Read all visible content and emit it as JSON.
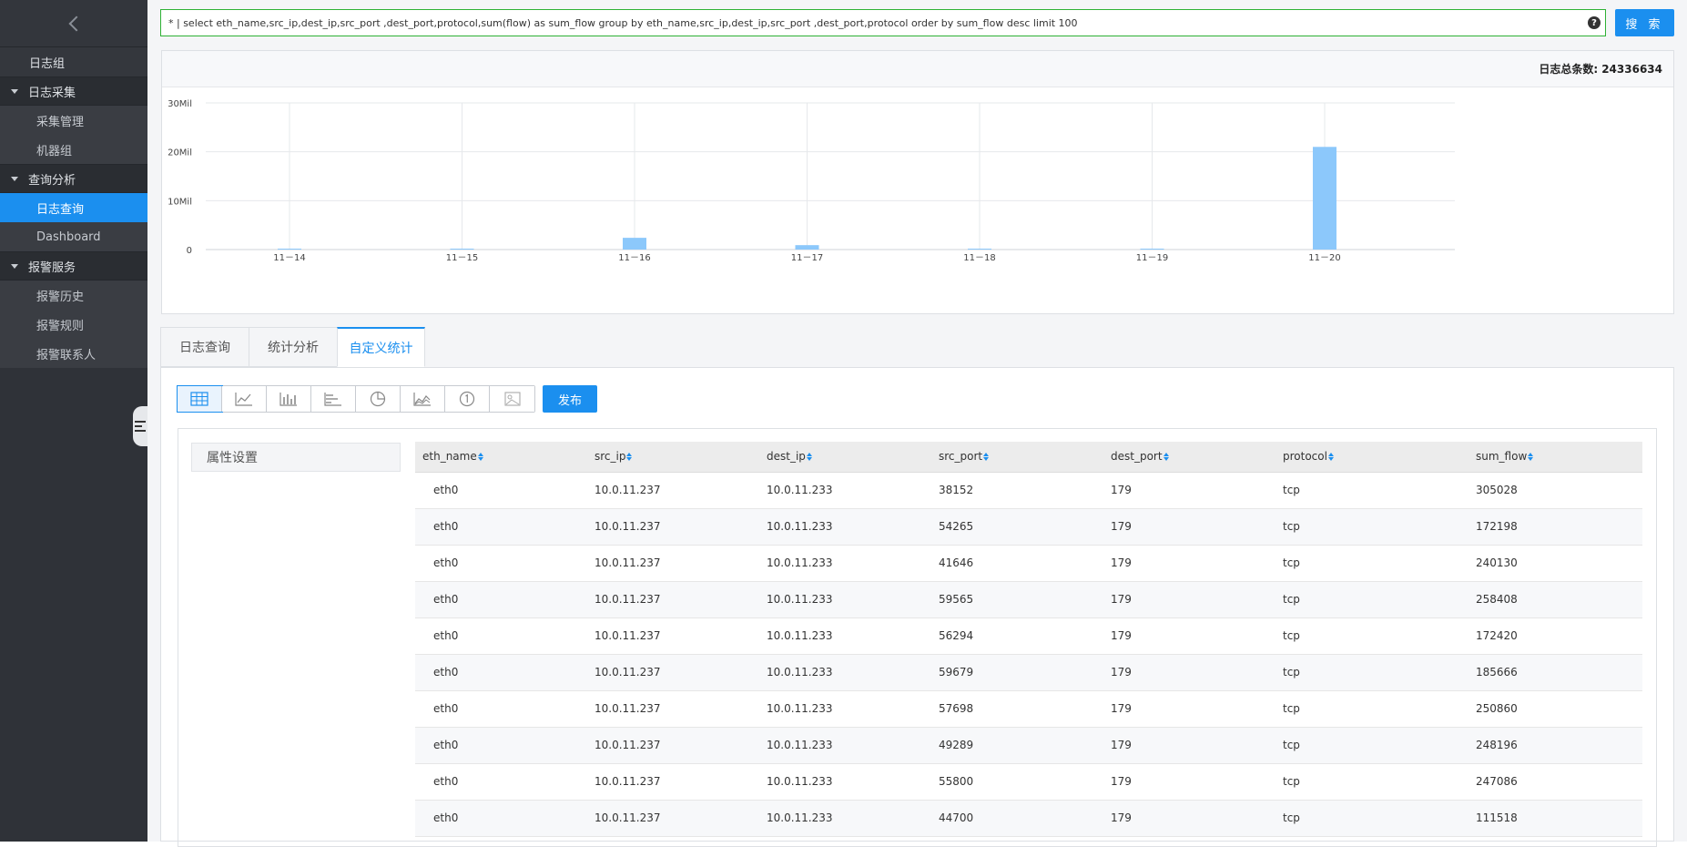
{
  "sidebar": {
    "items": [
      {
        "label": "日志组",
        "kind": "top"
      },
      {
        "label": "日志采集",
        "kind": "group"
      },
      {
        "label": "采集管理",
        "kind": "sub"
      },
      {
        "label": "机器组",
        "kind": "sub"
      },
      {
        "label": "查询分析",
        "kind": "group"
      },
      {
        "label": "日志查询",
        "kind": "sub",
        "active": true
      },
      {
        "label": "Dashboard",
        "kind": "sub"
      },
      {
        "label": "报警服务",
        "kind": "group"
      },
      {
        "label": "报警历史",
        "kind": "sub"
      },
      {
        "label": "报警规则",
        "kind": "sub"
      },
      {
        "label": "报警联系人",
        "kind": "sub"
      }
    ]
  },
  "search": {
    "query": "* | select eth_name,src_ip,dest_ip,src_port ,dest_port,protocol,sum(flow) as sum_flow group by eth_name,src_ip,dest_ip,src_port ,dest_port,protocol order by sum_flow desc limit 100",
    "help": "?",
    "button": "搜 索"
  },
  "histogram": {
    "total_label": "日志总条数:",
    "total_value": "24336634"
  },
  "chart_data": {
    "type": "bar",
    "categories": [
      "11－14",
      "11－15",
      "11－16",
      "11－17",
      "11－18",
      "11－19",
      "11－20"
    ],
    "values": [
      0.1,
      0.1,
      2.4,
      0.9,
      0.1,
      0.1,
      21.0
    ],
    "ytick_labels": [
      "0",
      "10Mil",
      "20Mil",
      "30Mil"
    ],
    "ylim": [
      0,
      30
    ],
    "grid": true,
    "color": "#8cc8fb"
  },
  "tabs": [
    {
      "label": "日志查询"
    },
    {
      "label": "统计分析"
    },
    {
      "label": "自定义统计",
      "active": true
    }
  ],
  "toolbar": {
    "chart_types": [
      "table-icon",
      "line-chart-icon",
      "bar-chart-icon",
      "horizontal-bar-icon",
      "pie-chart-icon",
      "area-chart-icon",
      "number-icon",
      "map-icon"
    ],
    "publish": "发布"
  },
  "attr_settings": "属性设置",
  "table": {
    "columns": [
      "eth_name",
      "src_ip",
      "dest_ip",
      "src_port",
      "dest_port",
      "protocol",
      "sum_flow"
    ],
    "rows": [
      [
        "eth0",
        "10.0.11.237",
        "10.0.11.233",
        "38152",
        "179",
        "tcp",
        "305028"
      ],
      [
        "eth0",
        "10.0.11.237",
        "10.0.11.233",
        "54265",
        "179",
        "tcp",
        "172198"
      ],
      [
        "eth0",
        "10.0.11.237",
        "10.0.11.233",
        "41646",
        "179",
        "tcp",
        "240130"
      ],
      [
        "eth0",
        "10.0.11.237",
        "10.0.11.233",
        "59565",
        "179",
        "tcp",
        "258408"
      ],
      [
        "eth0",
        "10.0.11.237",
        "10.0.11.233",
        "56294",
        "179",
        "tcp",
        "172420"
      ],
      [
        "eth0",
        "10.0.11.237",
        "10.0.11.233",
        "59679",
        "179",
        "tcp",
        "185666"
      ],
      [
        "eth0",
        "10.0.11.237",
        "10.0.11.233",
        "57698",
        "179",
        "tcp",
        "250860"
      ],
      [
        "eth0",
        "10.0.11.237",
        "10.0.11.233",
        "49289",
        "179",
        "tcp",
        "248196"
      ],
      [
        "eth0",
        "10.0.11.237",
        "10.0.11.233",
        "55800",
        "179",
        "tcp",
        "247086"
      ],
      [
        "eth0",
        "10.0.11.237",
        "10.0.11.233",
        "44700",
        "179",
        "tcp",
        "111518"
      ]
    ]
  }
}
